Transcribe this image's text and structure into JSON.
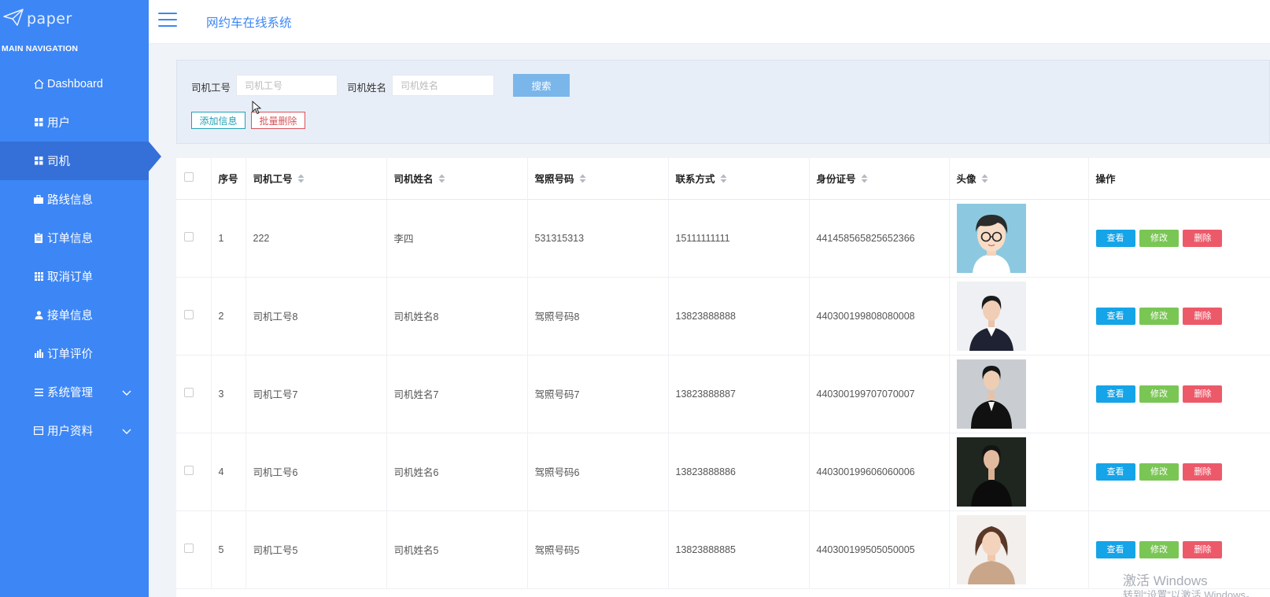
{
  "sidebar": {
    "logo_text": "paper",
    "heading": "MAIN NAVIGATION",
    "items": [
      {
        "label": "Dashboard",
        "icon": "home-icon"
      },
      {
        "label": "用户",
        "icon": "grid-icon"
      },
      {
        "label": "司机",
        "icon": "grid-icon",
        "active": true
      },
      {
        "label": "路线信息",
        "icon": "briefcase-icon"
      },
      {
        "label": "订单信息",
        "icon": "clipboard-icon"
      },
      {
        "label": "取消订单",
        "icon": "grid9-icon"
      },
      {
        "label": "接单信息",
        "icon": "user-icon"
      },
      {
        "label": "订单评价",
        "icon": "bar-chart-icon"
      },
      {
        "label": "系统管理",
        "icon": "list-icon",
        "expandable": true
      },
      {
        "label": "用户资料",
        "icon": "card-icon",
        "expandable": true
      }
    ]
  },
  "header": {
    "title": "网约车在线系统"
  },
  "search": {
    "driver_no_label": "司机工号",
    "driver_no_placeholder": "司机工号",
    "driver_no_value": "",
    "driver_name_label": "司机姓名",
    "driver_name_placeholder": "司机姓名",
    "driver_name_value": "",
    "search_button": "搜索",
    "add_button": "添加信息",
    "batch_delete_button": "批量删除"
  },
  "table": {
    "columns": [
      "序号",
      "司机工号",
      "司机姓名",
      "驾照号码",
      "联系方式",
      "身份证号",
      "头像",
      "操作"
    ],
    "rows": [
      {
        "index": "1",
        "driver_no": "222",
        "name": "李四",
        "license": "531315313",
        "phone": "15111111111",
        "id_card": "441458565825652366",
        "avatar": "cartoon-man"
      },
      {
        "index": "2",
        "driver_no": "司机工号8",
        "name": "司机姓名8",
        "license": "驾照号码8",
        "phone": "13823888888",
        "id_card": "440300199808080008",
        "avatar": "woman-dark-suit"
      },
      {
        "index": "3",
        "driver_no": "司机工号7",
        "name": "司机姓名7",
        "license": "驾照号码7",
        "phone": "13823888887",
        "id_card": "440300199707070007",
        "avatar": "woman-black-suit"
      },
      {
        "index": "4",
        "driver_no": "司机工号6",
        "name": "司机姓名6",
        "license": "驾照号码6",
        "phone": "13823888886",
        "id_card": "440300199606060006",
        "avatar": "woman-dark-bg"
      },
      {
        "index": "5",
        "driver_no": "司机工号5",
        "name": "司机姓名5",
        "license": "驾照号码5",
        "phone": "13823888885",
        "id_card": "440300199505050005",
        "avatar": "woman-beige"
      }
    ],
    "actions": {
      "view": "查看",
      "edit": "修改",
      "delete": "删除"
    }
  },
  "watermark": {
    "line1": "激活 Windows",
    "line2": "转到“设置”以激活 Windows。"
  },
  "colors": {
    "sidebar": "#3d86f5",
    "sidebar_active": "#3570d8",
    "accent": "#3d86f5",
    "view": "#15a4e8",
    "edit": "#7ac655",
    "delete": "#ec5a6a"
  }
}
